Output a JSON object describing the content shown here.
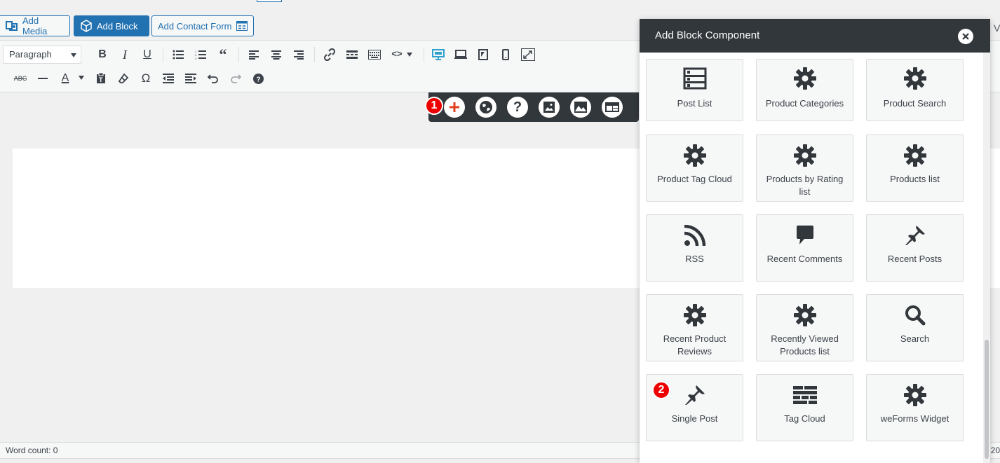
{
  "media_buttons": {
    "add_media": "Add Media",
    "add_block": "Add Block",
    "add_contact_form": "Add Contact Form"
  },
  "toolbar": {
    "format_value": "Paragraph",
    "icons": [
      "bold-icon",
      "italic-icon",
      "underline-icon",
      "bullet-list-icon",
      "numbered-list-icon",
      "blockquote-icon",
      "align-left-icon",
      "align-center-icon",
      "align-right-icon",
      "link-icon",
      "read-more-icon",
      "toolbar-toggle-icon",
      "code-icon",
      "desktop-view-icon",
      "laptop-view-icon",
      "tablet-view-icon",
      "mobile-view-icon",
      "fullscreen-icon",
      "strikethrough-icon",
      "horizontal-line-icon",
      "text-color-icon",
      "paste-text-icon",
      "clear-formatting-icon",
      "special-character-icon",
      "outdent-icon",
      "indent-icon",
      "undo-icon",
      "redo-icon",
      "help-icon"
    ]
  },
  "floating_bar": {
    "badge": "1",
    "icons": [
      "plus-icon",
      "globe-icon",
      "question-icon",
      "image-icon",
      "landscape-icon",
      "layout-icon"
    ],
    "accent": "#e2401c"
  },
  "modal": {
    "title": "Add Block Component",
    "badge": "2",
    "components": [
      {
        "label": "Post List",
        "icon": "post-list-icon"
      },
      {
        "label": "Product Categories",
        "icon": "gear-icon"
      },
      {
        "label": "Product Search",
        "icon": "gear-icon"
      },
      {
        "label": "Product Tag Cloud",
        "icon": "gear-icon"
      },
      {
        "label": "Products by Rating list",
        "icon": "gear-icon"
      },
      {
        "label": "Products list",
        "icon": "gear-icon"
      },
      {
        "label": "RSS",
        "icon": "rss-icon"
      },
      {
        "label": "Recent Comments",
        "icon": "comment-icon"
      },
      {
        "label": "Recent Posts",
        "icon": "pin-icon"
      },
      {
        "label": "Recent Product Reviews",
        "icon": "gear-icon"
      },
      {
        "label": "Recently Viewed Products list",
        "icon": "gear-icon"
      },
      {
        "label": "Search",
        "icon": "search-icon"
      },
      {
        "label": "Single Post",
        "icon": "pin-icon"
      },
      {
        "label": "Tag Cloud",
        "icon": "tag-cloud-icon"
      },
      {
        "label": "weForms Widget",
        "icon": "gear-icon"
      }
    ]
  },
  "status": {
    "word_count": "Word count: 0",
    "right_text": "20",
    "edge_letter": "V"
  },
  "colors": {
    "primary": "#2271b1",
    "dark": "#32373c",
    "badge": "#e00000",
    "active_view": "#2ea2cc"
  }
}
